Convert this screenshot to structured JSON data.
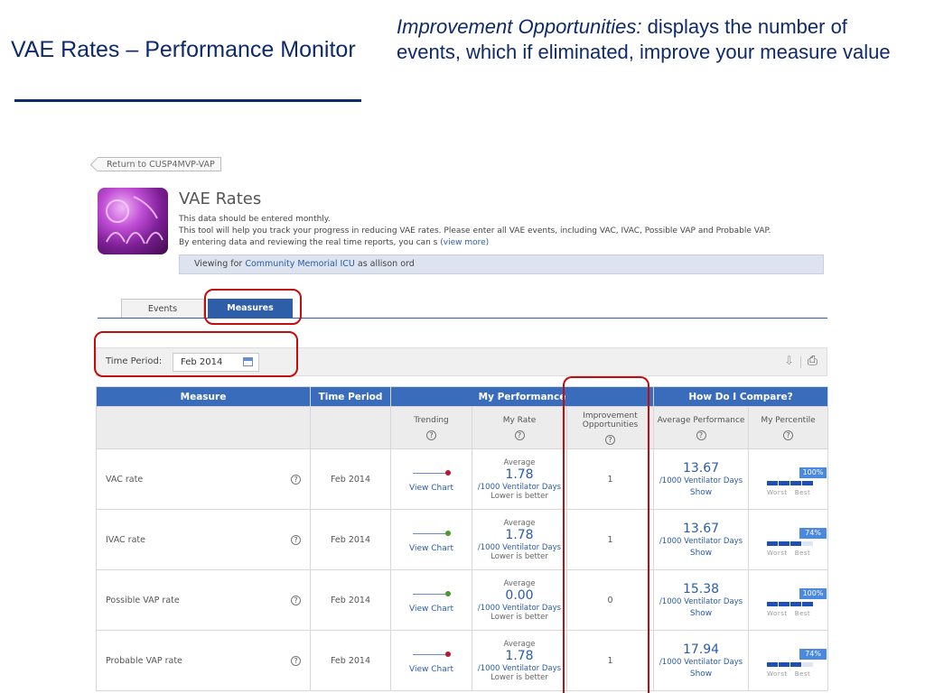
{
  "slide": {
    "title": "VAE Rates – Performance Monitor",
    "note_emphasis": "Improvement Opportunities:",
    "note_rest": " displays the number of events, which if eliminated, improve your measure value"
  },
  "app": {
    "return_label": "Return to CUSP4MVP-VAP",
    "title": "VAE Rates",
    "desc_line1": "This data should be entered monthly.",
    "desc_line2": "This tool will help you track your progress in reducing VAE rates. Please enter all VAE events, including VAC, IVAC, Possible VAP and Probable VAP.",
    "desc_line3": "By entering data and reviewing the real time reports, you can s",
    "view_more": "(view more)",
    "viewing_prefix": "Viewing for ",
    "unit_name": "Community Memorial ICU",
    "viewing_suffix": " as allison ord"
  },
  "tabs": [
    {
      "label": "Events",
      "active": false
    },
    {
      "label": "Measures",
      "active": true
    }
  ],
  "filter": {
    "label": "Time Period:",
    "value": "Feb 2014"
  },
  "table": {
    "header": {
      "measure": "Measure",
      "time_period": "Time Period",
      "my_performance": "My Performance",
      "compare": "How Do I Compare?"
    },
    "subheader": {
      "trending": "Trending",
      "my_rate": "My Rate",
      "improvement": "Improvement Opportunities",
      "average": "Average Performance",
      "percentile": "My Percentile",
      "help": "?"
    },
    "rows": [
      {
        "measure": "VAC rate",
        "period": "Feb 2014",
        "trend_color": "#c0142a",
        "view_chart": "View Chart",
        "rate_label": "Average",
        "rate": "1.78",
        "rate_unit": "/1000 Ventilator Days",
        "rate_note": "Lower is better",
        "improve": "1",
        "avg": "13.67",
        "avg_unit": "/1000 Ventilator Days",
        "show": "Show",
        "percentile": "100%",
        "percentile_value": 100
      },
      {
        "measure": "IVAC rate",
        "period": "Feb 2014",
        "trend_color": "#4a9a2a",
        "view_chart": "View Chart",
        "rate_label": "Average",
        "rate": "1.78",
        "rate_unit": "/1000 Ventilator Days",
        "rate_note": "Lower is better",
        "improve": "1",
        "avg": "13.67",
        "avg_unit": "/1000 Ventilator Days",
        "show": "Show",
        "percentile": "74%",
        "percentile_value": 74
      },
      {
        "measure": "Possible VAP rate",
        "period": "Feb 2014",
        "trend_color": "#4a9a2a",
        "view_chart": "View Chart",
        "rate_label": "Average",
        "rate": "0.00",
        "rate_unit": "/1000 Ventilator Days",
        "rate_note": "Lower is better",
        "improve": "0",
        "avg": "15.38",
        "avg_unit": "/1000 Ventilator Days",
        "show": "Show",
        "percentile": "100%",
        "percentile_value": 100
      },
      {
        "measure": "Probable VAP rate",
        "period": "Feb 2014",
        "trend_color": "#c0142a",
        "view_chart": "View Chart",
        "rate_label": "Average",
        "rate": "1.78",
        "rate_unit": "/1000 Ventilator Days",
        "rate_note": "Lower is better",
        "improve": "1",
        "avg": "17.94",
        "avg_unit": "/1000 Ventilator Days",
        "show": "Show",
        "percentile": "74%",
        "percentile_value": 74
      }
    ],
    "percentile_worst": "Worst",
    "percentile_best": "Best"
  },
  "colors": {
    "highlight": "#c00d0d",
    "header_blue": "#3a6cbc",
    "link_blue": "#2a5ca8"
  }
}
